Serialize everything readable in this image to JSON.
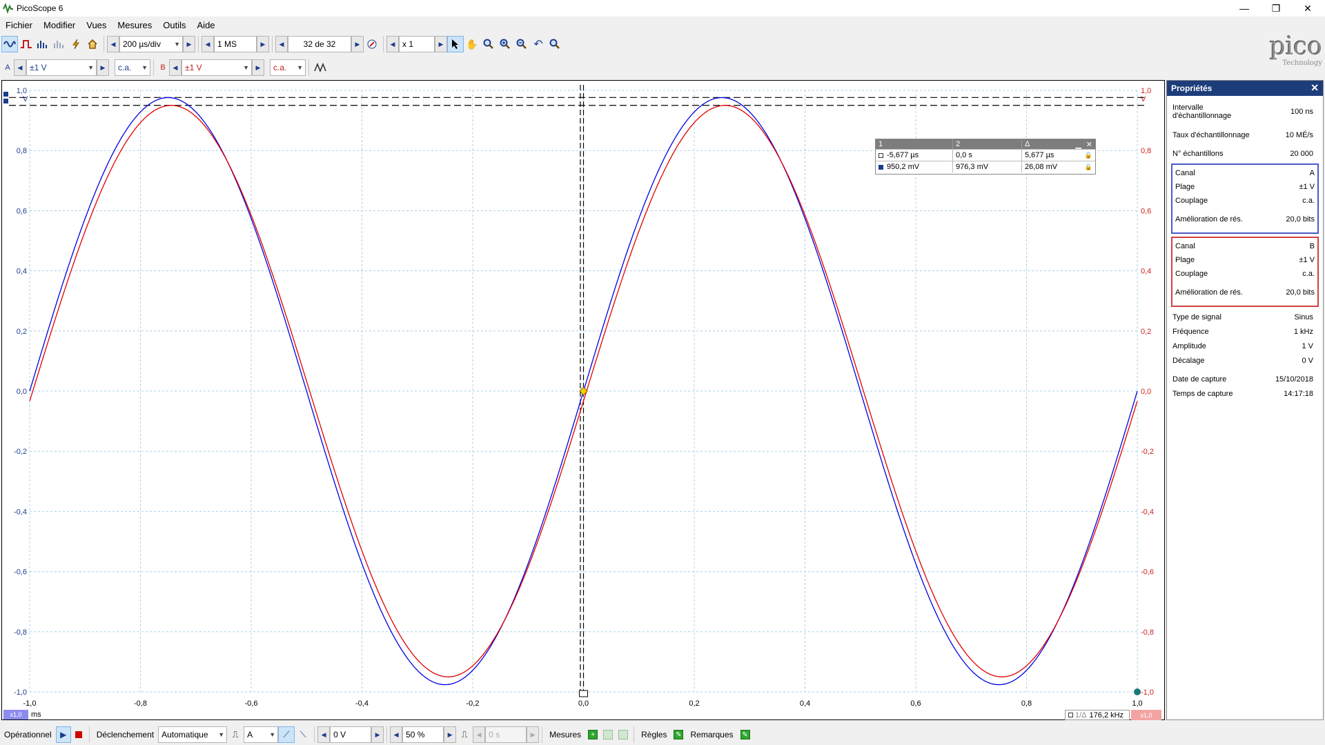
{
  "window": {
    "title": "PicoScope 6"
  },
  "menu": [
    "Fichier",
    "Modifier",
    "Vues",
    "Mesures",
    "Outils",
    "Aide"
  ],
  "toolbar": {
    "timebase": "200 µs/div",
    "samples": "1 MS",
    "buffer": "32 de 32",
    "zoom": "x 1"
  },
  "channels": {
    "a": {
      "label": "A",
      "range": "±1 V",
      "coupling": "c.a."
    },
    "b": {
      "label": "B",
      "range": "±1 V",
      "coupling": "c.a."
    }
  },
  "graph": {
    "y_ticks_left": [
      "1,0",
      "0,8",
      "0,6",
      "0,4",
      "0,2",
      "0,0",
      "-0,2",
      "-0,4",
      "-0,6",
      "-0,8",
      "-1,0"
    ],
    "y_ticks_right": [
      "1,0",
      "0,8",
      "0,6",
      "0,4",
      "0,2",
      "0,0",
      "-0,2",
      "-0,4",
      "-0,6",
      "-0,8",
      "-1,0"
    ],
    "x_ticks": [
      "-1,0",
      "-0,8",
      "-0,6",
      "-0,4",
      "-0,2",
      "0,0",
      "0,2",
      "0,4",
      "0,6",
      "0,8",
      "1,0"
    ],
    "x_unit": "ms",
    "left_unit": "V",
    "right_unit": "V",
    "x_scale": "x1,0",
    "freq_readout": "176,2 kHz",
    "freq_prefix": "1/Δ",
    "right_scale": "x1,0"
  },
  "chart_data": {
    "type": "line",
    "xlabel": "ms",
    "ylabel": "V",
    "xlim": [
      -1.0,
      1.0
    ],
    "ylim": [
      -1.0,
      1.0
    ],
    "grid": true,
    "series": [
      {
        "name": "A",
        "color": "#0000e0",
        "function": "sine",
        "frequency_khz": 1,
        "amplitude": 0.976,
        "phase_deg": 0
      },
      {
        "name": "B",
        "color": "#e00000",
        "function": "sine",
        "frequency_khz": 1,
        "amplitude": 0.95,
        "phase_deg": -2
      }
    ]
  },
  "measurements": {
    "headers": [
      "1",
      "2",
      "Δ"
    ],
    "rows": [
      [
        "-5,677 µs",
        "0,0 s",
        "5,677 µs"
      ],
      [
        "950,2 mV",
        "976,3 mV",
        "26,08 mV"
      ]
    ]
  },
  "properties": {
    "title": "Propriétés",
    "general": [
      {
        "label": "Intervalle d'échantillonnage",
        "value": "100 ns"
      },
      {
        "label": "Taux d'échantillonnage",
        "value": "10 MÉ/s"
      },
      {
        "label": "N° échantillons",
        "value": "20 000"
      }
    ],
    "chan_a": [
      {
        "label": "Canal",
        "value": "A"
      },
      {
        "label": "Plage",
        "value": "±1 V"
      },
      {
        "label": "Couplage",
        "value": "c.a."
      },
      {
        "label": "Amélioration de rés.",
        "value": "20,0 bits"
      }
    ],
    "chan_b": [
      {
        "label": "Canal",
        "value": "B"
      },
      {
        "label": "Plage",
        "value": "±1 V"
      },
      {
        "label": "Couplage",
        "value": "c.a."
      },
      {
        "label": "Amélioration de rés.",
        "value": "20,0 bits"
      }
    ],
    "signal": [
      {
        "label": "Type de signal",
        "value": "Sinus"
      },
      {
        "label": "Fréquence",
        "value": "1 kHz"
      },
      {
        "label": "Amplitude",
        "value": "1 V"
      },
      {
        "label": "Décalage",
        "value": "0 V"
      }
    ],
    "capture": [
      {
        "label": "Date de capture",
        "value": "15/10/2018"
      },
      {
        "label": "Temps de capture",
        "value": "14:17:18"
      }
    ]
  },
  "status": {
    "operational": "Opérationnel",
    "trigger_label": "Déclenchement",
    "trigger_mode": "Automatique",
    "trigger_channel": "A",
    "trigger_level": "0 V",
    "trigger_pos": "50 %",
    "delay": "0 s",
    "measures": "Mesures",
    "rules": "Règles",
    "notes": "Remarques"
  },
  "brand": {
    "logo": "pico",
    "sub": "Technology"
  }
}
